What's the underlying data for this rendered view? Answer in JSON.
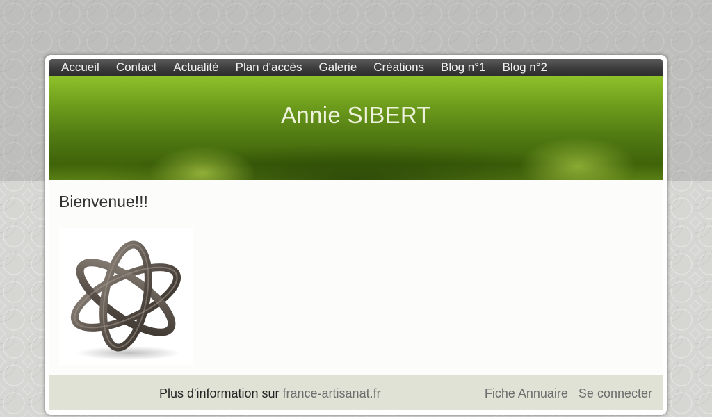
{
  "nav": {
    "items": [
      {
        "label": "Accueil"
      },
      {
        "label": "Contact"
      },
      {
        "label": "Actualité"
      },
      {
        "label": "Plan d'accès"
      },
      {
        "label": "Galerie"
      },
      {
        "label": "Créations"
      },
      {
        "label": "Blog n°1"
      },
      {
        "label": "Blog n°2"
      }
    ]
  },
  "header": {
    "site_title": "Annie SIBERT"
  },
  "main": {
    "heading": "Bienvenue!!!",
    "image_icon": "metal-knot-sculpture"
  },
  "footer": {
    "info_prefix": "Plus d'information sur",
    "info_link": "france-artisanat.fr",
    "directory_link": "Fiche Annuaire",
    "login_link": "Se connecter"
  },
  "colors": {
    "nav_bg": "#3a3a3a",
    "banner_green": "#4f7812",
    "footer_bg": "#dfe2d5"
  }
}
